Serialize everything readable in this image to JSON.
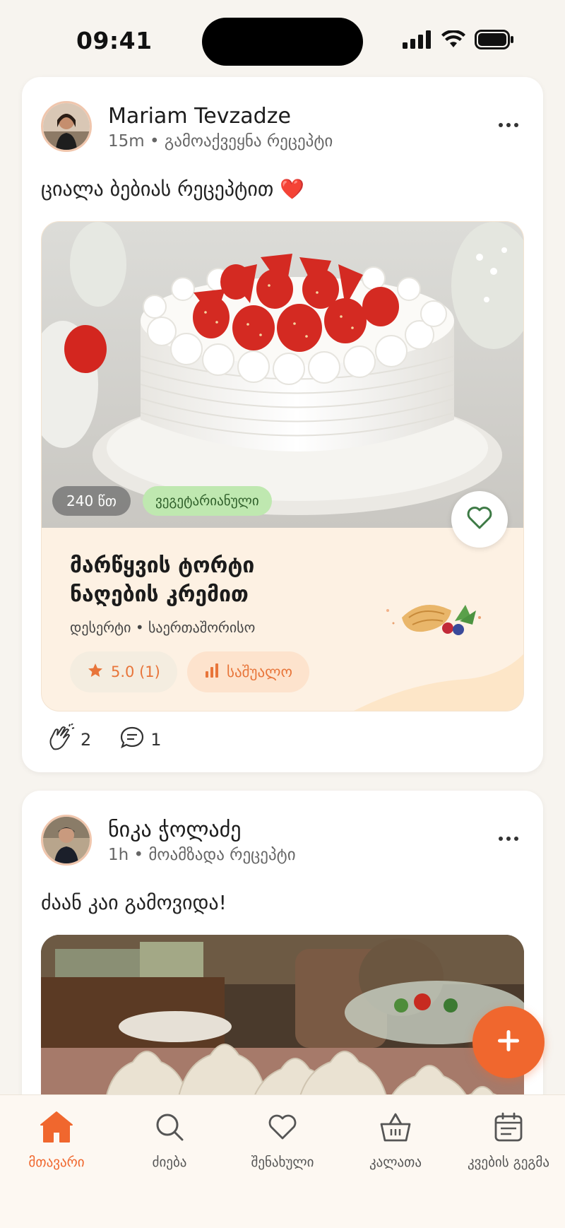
{
  "status_bar": {
    "time": "09:41"
  },
  "posts": [
    {
      "author": "Mariam Tevzadze",
      "meta": "15m • გამოაქვეყნა რეცეპტი",
      "caption": "ციალა ბებიას რეცეპტით ❤️",
      "recipe": {
        "time_tag": "240 წთ",
        "diet_tag": "ვეგეტარიანული",
        "title_line1": "მარწყვის ტორტი",
        "title_line2": "ნაღების კრემით",
        "subtitle": "დესერტი • საერთაშორისო",
        "rating": "5.0 (1)",
        "difficulty": "საშუალო"
      },
      "claps": "2",
      "comments": "1"
    },
    {
      "author": "ნიკა ჭოლაძე",
      "meta": "1h • მოამზადა რეცეპტი",
      "caption": "ძაან კაი გამოვიდა!"
    }
  ],
  "nav": {
    "home": "მთავარი",
    "search": "ძიება",
    "saved": "შენახული",
    "basket": "კალათა",
    "meal_plan": "კვების გეგმა"
  },
  "colors": {
    "accent": "#f0672e",
    "veg_tag_bg": "#bfe8b0",
    "recipe_bg": "#fdf1e3"
  }
}
